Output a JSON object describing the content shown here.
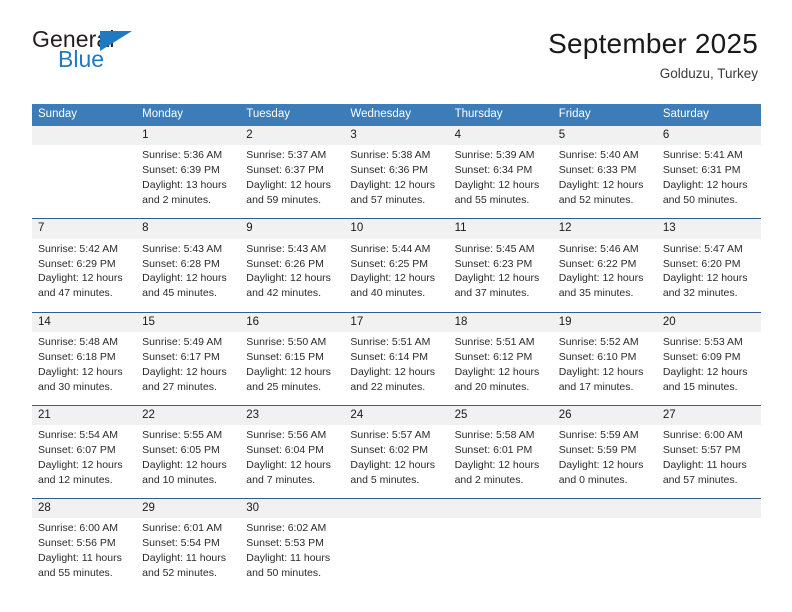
{
  "brand": {
    "name_top": "General",
    "name_bottom": "Blue",
    "accent_color": "#1f7ac1"
  },
  "header": {
    "title": "September 2025",
    "location": "Golduzu, Turkey"
  },
  "theme": {
    "header_row_bg": "#3b7cb9",
    "date_row_bg": "#f1f1f1",
    "week_separator": "#2f5f92",
    "text": "#2b2b2b"
  },
  "calendar": {
    "weekday_headers": [
      "Sunday",
      "Monday",
      "Tuesday",
      "Wednesday",
      "Thursday",
      "Friday",
      "Saturday"
    ],
    "weeks": [
      {
        "days": [
          {
            "num": "",
            "sunrise": "",
            "sunset": "",
            "daylight_1": "",
            "daylight_2": ""
          },
          {
            "num": "1",
            "sunrise": "Sunrise: 5:36 AM",
            "sunset": "Sunset: 6:39 PM",
            "daylight_1": "Daylight: 13 hours",
            "daylight_2": "and 2 minutes."
          },
          {
            "num": "2",
            "sunrise": "Sunrise: 5:37 AM",
            "sunset": "Sunset: 6:37 PM",
            "daylight_1": "Daylight: 12 hours",
            "daylight_2": "and 59 minutes."
          },
          {
            "num": "3",
            "sunrise": "Sunrise: 5:38 AM",
            "sunset": "Sunset: 6:36 PM",
            "daylight_1": "Daylight: 12 hours",
            "daylight_2": "and 57 minutes."
          },
          {
            "num": "4",
            "sunrise": "Sunrise: 5:39 AM",
            "sunset": "Sunset: 6:34 PM",
            "daylight_1": "Daylight: 12 hours",
            "daylight_2": "and 55 minutes."
          },
          {
            "num": "5",
            "sunrise": "Sunrise: 5:40 AM",
            "sunset": "Sunset: 6:33 PM",
            "daylight_1": "Daylight: 12 hours",
            "daylight_2": "and 52 minutes."
          },
          {
            "num": "6",
            "sunrise": "Sunrise: 5:41 AM",
            "sunset": "Sunset: 6:31 PM",
            "daylight_1": "Daylight: 12 hours",
            "daylight_2": "and 50 minutes."
          }
        ]
      },
      {
        "days": [
          {
            "num": "7",
            "sunrise": "Sunrise: 5:42 AM",
            "sunset": "Sunset: 6:29 PM",
            "daylight_1": "Daylight: 12 hours",
            "daylight_2": "and 47 minutes."
          },
          {
            "num": "8",
            "sunrise": "Sunrise: 5:43 AM",
            "sunset": "Sunset: 6:28 PM",
            "daylight_1": "Daylight: 12 hours",
            "daylight_2": "and 45 minutes."
          },
          {
            "num": "9",
            "sunrise": "Sunrise: 5:43 AM",
            "sunset": "Sunset: 6:26 PM",
            "daylight_1": "Daylight: 12 hours",
            "daylight_2": "and 42 minutes."
          },
          {
            "num": "10",
            "sunrise": "Sunrise: 5:44 AM",
            "sunset": "Sunset: 6:25 PM",
            "daylight_1": "Daylight: 12 hours",
            "daylight_2": "and 40 minutes."
          },
          {
            "num": "11",
            "sunrise": "Sunrise: 5:45 AM",
            "sunset": "Sunset: 6:23 PM",
            "daylight_1": "Daylight: 12 hours",
            "daylight_2": "and 37 minutes."
          },
          {
            "num": "12",
            "sunrise": "Sunrise: 5:46 AM",
            "sunset": "Sunset: 6:22 PM",
            "daylight_1": "Daylight: 12 hours",
            "daylight_2": "and 35 minutes."
          },
          {
            "num": "13",
            "sunrise": "Sunrise: 5:47 AM",
            "sunset": "Sunset: 6:20 PM",
            "daylight_1": "Daylight: 12 hours",
            "daylight_2": "and 32 minutes."
          }
        ]
      },
      {
        "days": [
          {
            "num": "14",
            "sunrise": "Sunrise: 5:48 AM",
            "sunset": "Sunset: 6:18 PM",
            "daylight_1": "Daylight: 12 hours",
            "daylight_2": "and 30 minutes."
          },
          {
            "num": "15",
            "sunrise": "Sunrise: 5:49 AM",
            "sunset": "Sunset: 6:17 PM",
            "daylight_1": "Daylight: 12 hours",
            "daylight_2": "and 27 minutes."
          },
          {
            "num": "16",
            "sunrise": "Sunrise: 5:50 AM",
            "sunset": "Sunset: 6:15 PM",
            "daylight_1": "Daylight: 12 hours",
            "daylight_2": "and 25 minutes."
          },
          {
            "num": "17",
            "sunrise": "Sunrise: 5:51 AM",
            "sunset": "Sunset: 6:14 PM",
            "daylight_1": "Daylight: 12 hours",
            "daylight_2": "and 22 minutes."
          },
          {
            "num": "18",
            "sunrise": "Sunrise: 5:51 AM",
            "sunset": "Sunset: 6:12 PM",
            "daylight_1": "Daylight: 12 hours",
            "daylight_2": "and 20 minutes."
          },
          {
            "num": "19",
            "sunrise": "Sunrise: 5:52 AM",
            "sunset": "Sunset: 6:10 PM",
            "daylight_1": "Daylight: 12 hours",
            "daylight_2": "and 17 minutes."
          },
          {
            "num": "20",
            "sunrise": "Sunrise: 5:53 AM",
            "sunset": "Sunset: 6:09 PM",
            "daylight_1": "Daylight: 12 hours",
            "daylight_2": "and 15 minutes."
          }
        ]
      },
      {
        "days": [
          {
            "num": "21",
            "sunrise": "Sunrise: 5:54 AM",
            "sunset": "Sunset: 6:07 PM",
            "daylight_1": "Daylight: 12 hours",
            "daylight_2": "and 12 minutes."
          },
          {
            "num": "22",
            "sunrise": "Sunrise: 5:55 AM",
            "sunset": "Sunset: 6:05 PM",
            "daylight_1": "Daylight: 12 hours",
            "daylight_2": "and 10 minutes."
          },
          {
            "num": "23",
            "sunrise": "Sunrise: 5:56 AM",
            "sunset": "Sunset: 6:04 PM",
            "daylight_1": "Daylight: 12 hours",
            "daylight_2": "and 7 minutes."
          },
          {
            "num": "24",
            "sunrise": "Sunrise: 5:57 AM",
            "sunset": "Sunset: 6:02 PM",
            "daylight_1": "Daylight: 12 hours",
            "daylight_2": "and 5 minutes."
          },
          {
            "num": "25",
            "sunrise": "Sunrise: 5:58 AM",
            "sunset": "Sunset: 6:01 PM",
            "daylight_1": "Daylight: 12 hours",
            "daylight_2": "and 2 minutes."
          },
          {
            "num": "26",
            "sunrise": "Sunrise: 5:59 AM",
            "sunset": "Sunset: 5:59 PM",
            "daylight_1": "Daylight: 12 hours",
            "daylight_2": "and 0 minutes."
          },
          {
            "num": "27",
            "sunrise": "Sunrise: 6:00 AM",
            "sunset": "Sunset: 5:57 PM",
            "daylight_1": "Daylight: 11 hours",
            "daylight_2": "and 57 minutes."
          }
        ]
      },
      {
        "days": [
          {
            "num": "28",
            "sunrise": "Sunrise: 6:00 AM",
            "sunset": "Sunset: 5:56 PM",
            "daylight_1": "Daylight: 11 hours",
            "daylight_2": "and 55 minutes."
          },
          {
            "num": "29",
            "sunrise": "Sunrise: 6:01 AM",
            "sunset": "Sunset: 5:54 PM",
            "daylight_1": "Daylight: 11 hours",
            "daylight_2": "and 52 minutes."
          },
          {
            "num": "30",
            "sunrise": "Sunrise: 6:02 AM",
            "sunset": "Sunset: 5:53 PM",
            "daylight_1": "Daylight: 11 hours",
            "daylight_2": "and 50 minutes."
          },
          {
            "num": "",
            "sunrise": "",
            "sunset": "",
            "daylight_1": "",
            "daylight_2": ""
          },
          {
            "num": "",
            "sunrise": "",
            "sunset": "",
            "daylight_1": "",
            "daylight_2": ""
          },
          {
            "num": "",
            "sunrise": "",
            "sunset": "",
            "daylight_1": "",
            "daylight_2": ""
          },
          {
            "num": "",
            "sunrise": "",
            "sunset": "",
            "daylight_1": "",
            "daylight_2": ""
          }
        ]
      }
    ]
  }
}
